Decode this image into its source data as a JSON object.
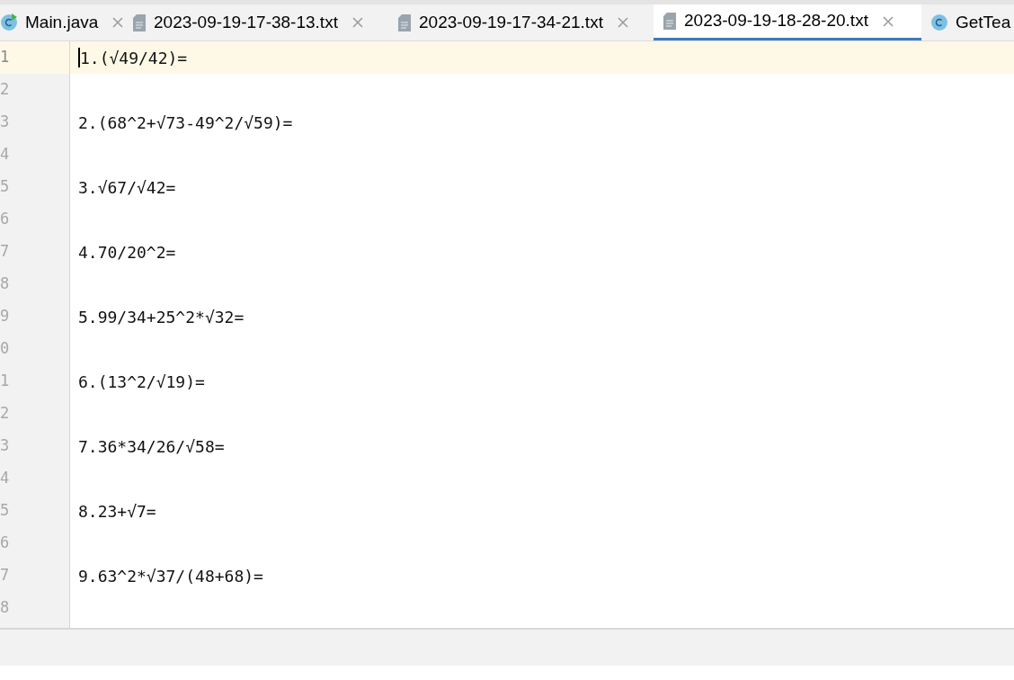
{
  "tabs": [
    {
      "label": "Main.java",
      "kind": "class",
      "run": true,
      "selected": false,
      "closable": true
    },
    {
      "label": "2023-09-19-17-38-13.txt",
      "kind": "text",
      "selected": false,
      "closable": true
    },
    {
      "label": "2023-09-19-17-34-21.txt",
      "kind": "text",
      "selected": false,
      "closable": true
    },
    {
      "label": "2023-09-19-18-28-20.txt",
      "kind": "text",
      "selected": true,
      "closable": true
    },
    {
      "label": "GetTea",
      "kind": "class",
      "run": false,
      "selected": false,
      "closable": false
    }
  ],
  "editor": {
    "lines": [
      {
        "number": "1",
        "text": "1.(√49/42)=",
        "current": true
      },
      {
        "number": "2",
        "current": false
      },
      {
        "number": "3",
        "text": "2.(68^2+√73-49^2/√59)=",
        "current": false
      },
      {
        "number": "4",
        "current": false
      },
      {
        "number": "5",
        "text": "3.√67/√42=",
        "current": false
      },
      {
        "number": "6",
        "current": false
      },
      {
        "number": "7",
        "text": "4.70/20^2=",
        "current": false
      },
      {
        "number": "8",
        "current": false
      },
      {
        "number": "9",
        "text": "5.99/34+25^2*√32=",
        "current": false
      },
      {
        "number": "0",
        "current": false
      },
      {
        "number": "1",
        "text": "6.(13^2/√19)=",
        "current": false
      },
      {
        "number": "2",
        "current": false
      },
      {
        "number": "3",
        "text": "7.36*34/26/√58=",
        "current": false
      },
      {
        "number": "4",
        "current": false
      },
      {
        "number": "5",
        "text": "8.23+√7=",
        "current": false
      },
      {
        "number": "6",
        "current": false
      },
      {
        "number": "7",
        "text": "9.63^2*√37/(48+68)=",
        "current": false
      },
      {
        "number": "8",
        "current": false
      }
    ]
  }
}
